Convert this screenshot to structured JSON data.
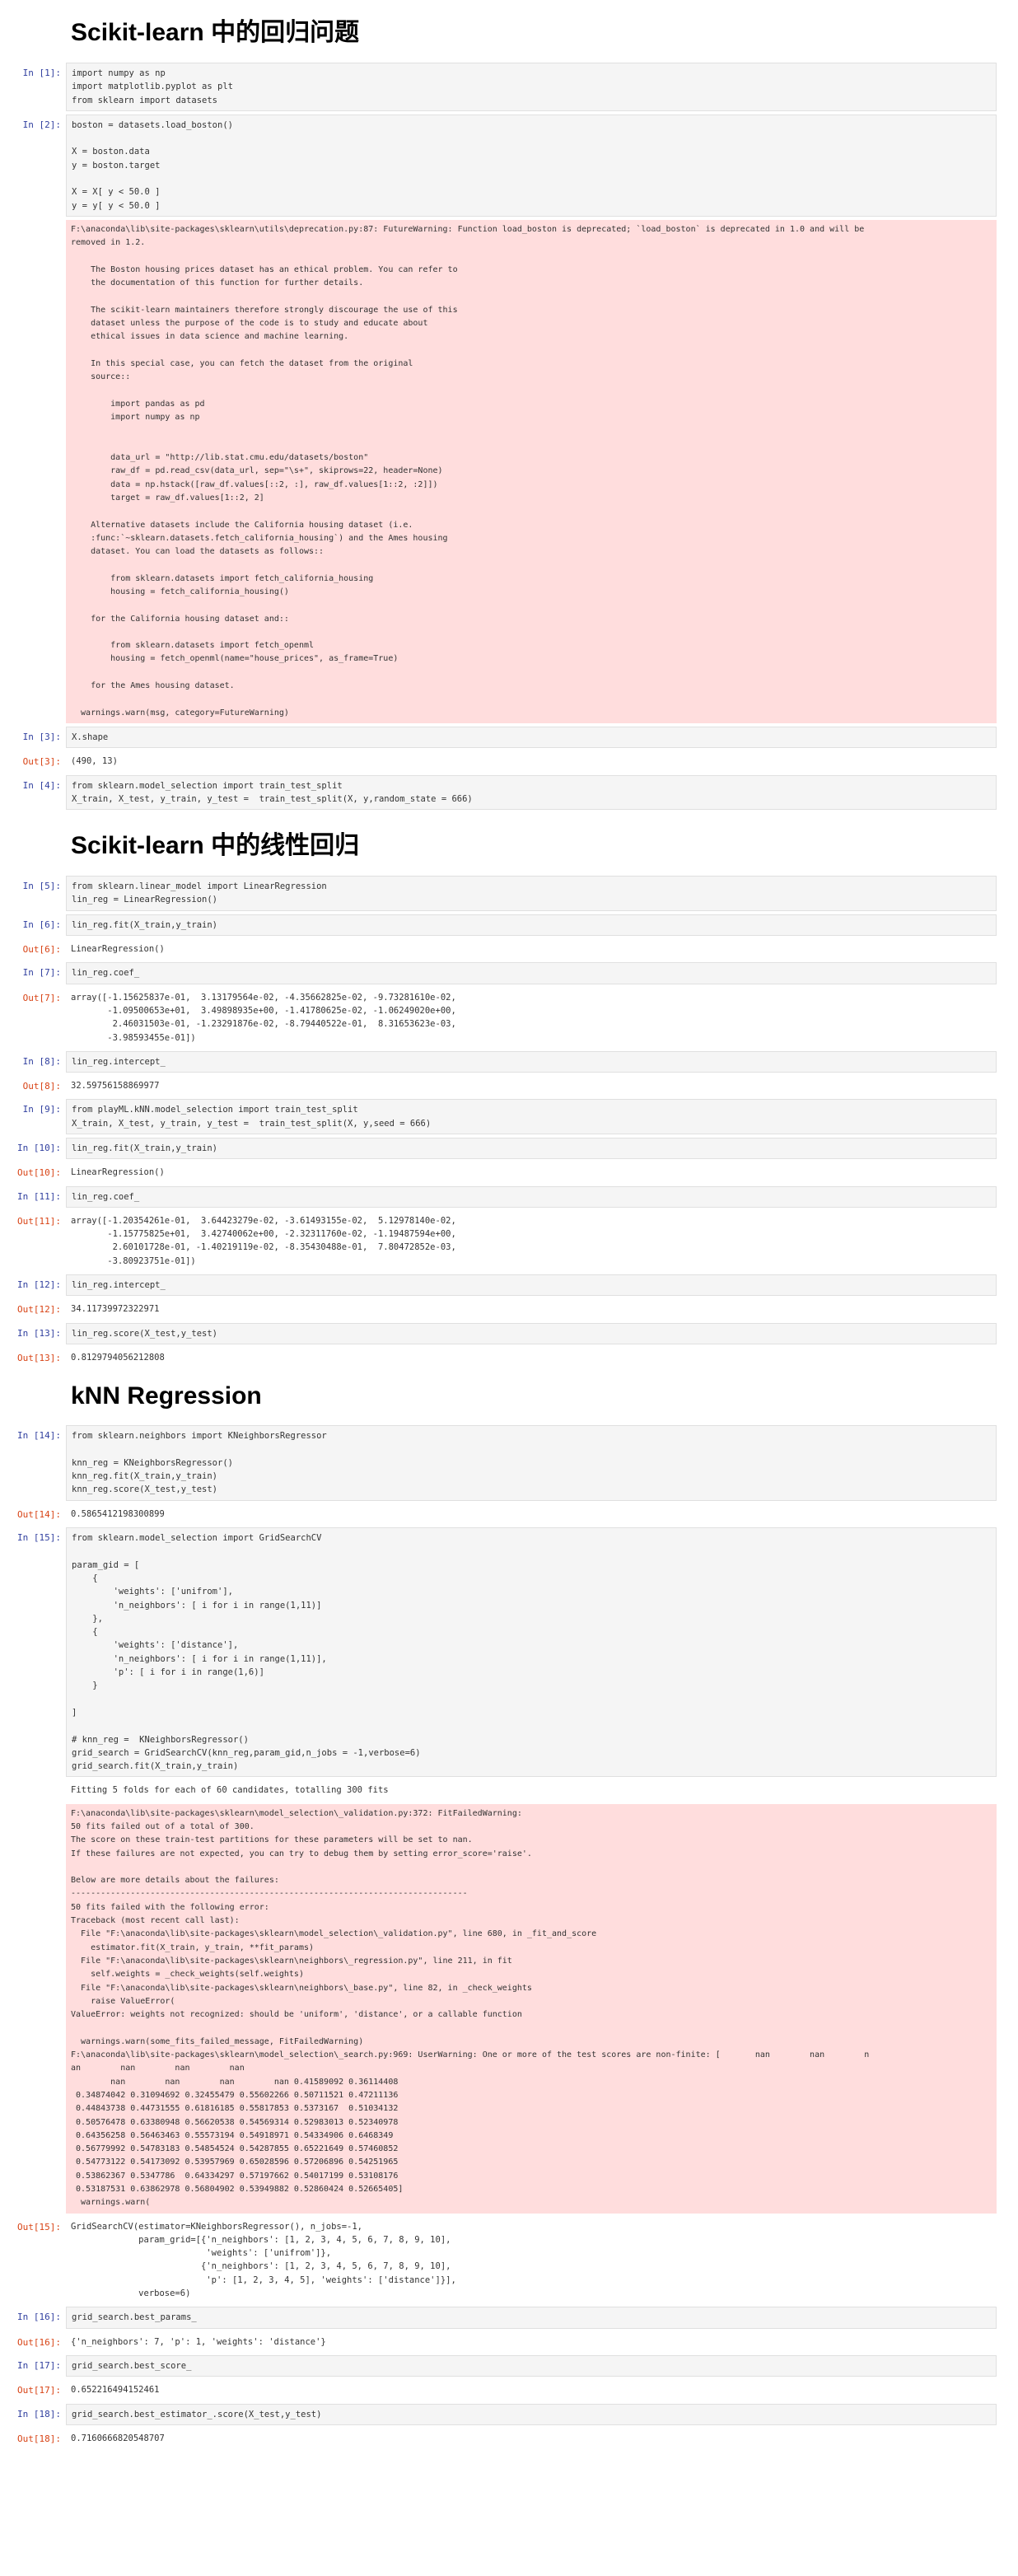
{
  "headings": {
    "h1": "Scikit-learn 中的回归问题",
    "h2": "Scikit-learn 中的线性回归",
    "h3": "kNN Regression"
  },
  "cells": {
    "c1": {
      "prompt": "In [1]:",
      "code": "import numpy as np\nimport matplotlib.pyplot as plt\nfrom sklearn import datasets"
    },
    "c2": {
      "prompt": "In [2]:",
      "code": "boston = datasets.load_boston()\n\nX = boston.data\ny = boston.target\n\nX = X[ y < 50.0 ]\ny = y[ y < 50.0 ]",
      "stderr": "F:\\anaconda\\lib\\site-packages\\sklearn\\utils\\deprecation.py:87: FutureWarning: Function load_boston is deprecated; `load_boston` is deprecated in 1.0 and will be\nremoved in 1.2.\n\n    The Boston housing prices dataset has an ethical problem. You can refer to\n    the documentation of this function for further details.\n\n    The scikit-learn maintainers therefore strongly discourage the use of this\n    dataset unless the purpose of the code is to study and educate about\n    ethical issues in data science and machine learning.\n\n    In this special case, you can fetch the dataset from the original\n    source::\n\n        import pandas as pd\n        import numpy as np\n\n\n        data_url = \"http://lib.stat.cmu.edu/datasets/boston\"\n        raw_df = pd.read_csv(data_url, sep=\"\\s+\", skiprows=22, header=None)\n        data = np.hstack([raw_df.values[::2, :], raw_df.values[1::2, :2]])\n        target = raw_df.values[1::2, 2]\n\n    Alternative datasets include the California housing dataset (i.e.\n    :func:`~sklearn.datasets.fetch_california_housing`) and the Ames housing\n    dataset. You can load the datasets as follows::\n\n        from sklearn.datasets import fetch_california_housing\n        housing = fetch_california_housing()\n\n    for the California housing dataset and::\n\n        from sklearn.datasets import fetch_openml\n        housing = fetch_openml(name=\"house_prices\", as_frame=True)\n\n    for the Ames housing dataset.\n\n  warnings.warn(msg, category=FutureWarning)"
    },
    "c3": {
      "prompt": "In [3]:",
      "code": "X.shape",
      "out_prompt": "Out[3]:",
      "out": "(490, 13)"
    },
    "c4": {
      "prompt": "In [4]:",
      "code": "from sklearn.model_selection import train_test_split\nX_train, X_test, y_train, y_test =  train_test_split(X, y,random_state = 666)"
    },
    "c5": {
      "prompt": "In [5]:",
      "code": "from sklearn.linear_model import LinearRegression\nlin_reg = LinearRegression()"
    },
    "c6": {
      "prompt": "In [6]:",
      "code": "lin_reg.fit(X_train,y_train)",
      "out_prompt": "Out[6]:",
      "out": "LinearRegression()"
    },
    "c7": {
      "prompt": "In [7]:",
      "code": "lin_reg.coef_",
      "out_prompt": "Out[7]:",
      "out": "array([-1.15625837e-01,  3.13179564e-02, -4.35662825e-02, -9.73281610e-02,\n       -1.09500653e+01,  3.49898935e+00, -1.41780625e-02, -1.06249020e+00,\n        2.46031503e-01, -1.23291876e-02, -8.79440522e-01,  8.31653623e-03,\n       -3.98593455e-01])"
    },
    "c8": {
      "prompt": "In [8]:",
      "code": "lin_reg.intercept_",
      "out_prompt": "Out[8]:",
      "out": "32.59756158869977"
    },
    "c9": {
      "prompt": "In [9]:",
      "code": "from playML.kNN.model_selection import train_test_split\nX_train, X_test, y_train, y_test =  train_test_split(X, y,seed = 666)"
    },
    "c10": {
      "prompt": "In [10]:",
      "code": "lin_reg.fit(X_train,y_train)",
      "out_prompt": "Out[10]:",
      "out": "LinearRegression()"
    },
    "c11": {
      "prompt": "In [11]:",
      "code": "lin_reg.coef_",
      "out_prompt": "Out[11]:",
      "out": "array([-1.20354261e-01,  3.64423279e-02, -3.61493155e-02,  5.12978140e-02,\n       -1.15775825e+01,  3.42740062e+00, -2.32311760e-02, -1.19487594e+00,\n        2.60101728e-01, -1.40219119e-02, -8.35430488e-01,  7.80472852e-03,\n       -3.80923751e-01])"
    },
    "c12": {
      "prompt": "In [12]:",
      "code": "lin_reg.intercept_",
      "out_prompt": "Out[12]:",
      "out": "34.11739972322971"
    },
    "c13": {
      "prompt": "In [13]:",
      "code": "lin_reg.score(X_test,y_test)",
      "out_prompt": "Out[13]:",
      "out": "0.8129794056212808"
    },
    "c14": {
      "prompt": "In [14]:",
      "code": "from sklearn.neighbors import KNeighborsRegressor\n\nknn_reg = KNeighborsRegressor()\nknn_reg.fit(X_train,y_train)\nknn_reg.score(X_test,y_test)",
      "out_prompt": "Out[14]:",
      "out": "0.5865412198300899"
    },
    "c15": {
      "prompt": "In [15]:",
      "code": "from sklearn.model_selection import GridSearchCV\n\nparam_gid = [\n    {\n        'weights': ['unifrom'],\n        'n_neighbors': [ i for i in range(1,11)]\n    },\n    {\n        'weights': ['distance'],\n        'n_neighbors': [ i for i in range(1,11)],\n        'p': [ i for i in range(1,6)]\n    }\n\n]\n\n# knn_reg =  KNeighborsRegressor()\ngrid_search = GridSearchCV(knn_reg,param_gid,n_jobs = -1,verbose=6)\ngrid_search.fit(X_train,y_train)",
      "stdout": "Fitting 5 folds for each of 60 candidates, totalling 300 fits",
      "stderr": "F:\\anaconda\\lib\\site-packages\\sklearn\\model_selection\\_validation.py:372: FitFailedWarning:\n50 fits failed out of a total of 300.\nThe score on these train-test partitions for these parameters will be set to nan.\nIf these failures are not expected, you can try to debug them by setting error_score='raise'.\n\nBelow are more details about the failures:\n--------------------------------------------------------------------------------\n50 fits failed with the following error:\nTraceback (most recent call last):\n  File \"F:\\anaconda\\lib\\site-packages\\sklearn\\model_selection\\_validation.py\", line 680, in _fit_and_score\n    estimator.fit(X_train, y_train, **fit_params)\n  File \"F:\\anaconda\\lib\\site-packages\\sklearn\\neighbors\\_regression.py\", line 211, in fit\n    self.weights = _check_weights(self.weights)\n  File \"F:\\anaconda\\lib\\site-packages\\sklearn\\neighbors\\_base.py\", line 82, in _check_weights\n    raise ValueError(\nValueError: weights not recognized: should be 'uniform', 'distance', or a callable function\n\n  warnings.warn(some_fits_failed_message, FitFailedWarning)\nF:\\anaconda\\lib\\site-packages\\sklearn\\model_selection\\_search.py:969: UserWarning: One or more of the test scores are non-finite: [       nan        nan        n\nan        nan        nan        nan\n        nan        nan        nan        nan 0.41589092 0.36114408\n 0.34874042 0.31094692 0.32455479 0.55602266 0.50711521 0.47211136\n 0.44843738 0.44731555 0.61816185 0.55817853 0.5373167  0.51034132\n 0.50576478 0.63380948 0.56620538 0.54569314 0.52983013 0.52340978\n 0.64356258 0.56463463 0.55573194 0.54918971 0.54334906 0.6468349\n 0.56779992 0.54783183 0.54854524 0.54287855 0.65221649 0.57460852\n 0.54773122 0.54173092 0.53957969 0.65028596 0.57206896 0.54251965\n 0.53862367 0.5347786  0.64334297 0.57197662 0.54017199 0.53108176\n 0.53187531 0.63862978 0.56804902 0.53949882 0.52860424 0.52665405]\n  warnings.warn(",
      "out_prompt": "Out[15]:",
      "out": "GridSearchCV(estimator=KNeighborsRegressor(), n_jobs=-1,\n             param_grid=[{'n_neighbors': [1, 2, 3, 4, 5, 6, 7, 8, 9, 10],\n                          'weights': ['unifrom']},\n                         {'n_neighbors': [1, 2, 3, 4, 5, 6, 7, 8, 9, 10],\n                          'p': [1, 2, 3, 4, 5], 'weights': ['distance']}],\n             verbose=6)"
    },
    "c16": {
      "prompt": "In [16]:",
      "code": "grid_search.best_params_",
      "out_prompt": "Out[16]:",
      "out": "{'n_neighbors': 7, 'p': 1, 'weights': 'distance'}"
    },
    "c17": {
      "prompt": "In [17]:",
      "code": "grid_search.best_score_",
      "out_prompt": "Out[17]:",
      "out": "0.652216494152461"
    },
    "c18": {
      "prompt": "In [18]:",
      "code": "grid_search.best_estimator_.score(X_test,y_test)",
      "out_prompt": "Out[18]:",
      "out": "0.7160666820548707"
    }
  }
}
